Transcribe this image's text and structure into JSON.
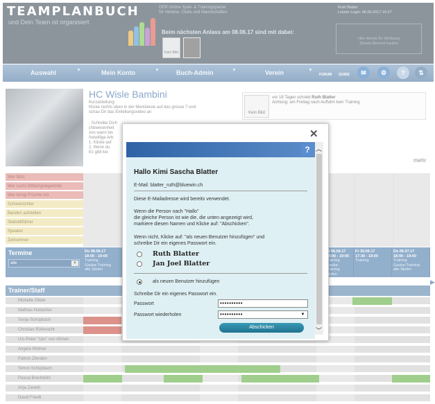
{
  "header": {
    "brand": "TEAMPLANBUCH",
    "tagline": "und Dein Team ist organisiert",
    "description_1": "DER Online Spiel- & Trainingsplaner",
    "description_2": "für Vereine, Clubs und Mannschaften",
    "user_name": "Ruth Blatter",
    "last_login": "Letzter Login: 06.06.2017 15:27",
    "next_event": "Beim nächsten Anlass am 08.06.17 sind mit dabei:",
    "kein_bild": "Kein Bild",
    "ad_line_1": "Hier könnte Ihr Werbung",
    "ad_line_2": "Diesen Bereich kaufen"
  },
  "nav": {
    "items": [
      "Auswahl",
      "Mein Konto",
      "Buch-Admin",
      "Verein"
    ],
    "forum": "FORUM",
    "guide": "GUIDE",
    "separator": "▼"
  },
  "club": {
    "title": "HC Wisle Bambini",
    "intro_label": "Kurzanleitung",
    "intro_1": "Klicke rechts oben in der Menüleiste auf das grosse ? und",
    "intro_2": "schau Dir das Einleitungsvideo an",
    "steps_1": "- Schreibe Dich",
    "steps_2": "(Abwesenheit",
    "steps_3": "von wann bis",
    "steps_4": "freiwillige Arb",
    "steps_5": "1. Klicke auf",
    "steps_6": "2. Wenn du",
    "steps_7": "Es gibt kei",
    "mehr": "mehr"
  },
  "message": {
    "kein_bild": "Kein Bild",
    "line_1_prefix": "vor 18 Tagen schrieb ",
    "author": "Ruth Blatter",
    "line_2": "Achtung: am Freitag nach Auffahrt kein Training"
  },
  "duties": [
    {
      "label": "Wer fährt",
      "tone": "red"
    },
    {
      "label": "Wer sucht Mitfahrgelegenheit",
      "tone": "red"
    },
    {
      "label": "Wer bringt Früchte mit",
      "tone": "red"
    },
    {
      "label": "Schiedsrichter",
      "tone": "yel"
    },
    {
      "label": "Banden aufstellen",
      "tone": "yel"
    },
    {
      "label": "Statistikführer",
      "tone": "yel"
    },
    {
      "label": "Speaker",
      "tone": "yel"
    },
    {
      "label": "Zeitnehmer",
      "tone": "yel"
    }
  ],
  "termine": {
    "label": "Termine",
    "select": "alle"
  },
  "events": [
    {
      "date": "Do 08.06.17",
      "time": "18:00 - 19:00",
      "l1": "Training",
      "l2": "Gauba-Training",
      "l3": "alle Stufen"
    },
    {
      "date": "Di 06.06.17",
      "time": "18:00 - 19:00",
      "l1": "Training",
      "l2": "Gauba-Training",
      "l3": "Stufen"
    },
    {
      "date": "Fr 30.06.17",
      "time": "17:30 - 19:00",
      "l1": "Training",
      "l2": "",
      "l3": ""
    },
    {
      "date": "Do 06.07.17",
      "time": "18:00 - 19:00",
      "l1": "Training",
      "l2": "Gauba-Training",
      "l3": "alle Stufen"
    }
  ],
  "trainer": {
    "label": "Trainer/Staff",
    "names": [
      "Michelle Ofeler",
      "Mathias Hubacher",
      "Sonja Schüpbach",
      "Christian Rüfenacht",
      "Urs-Peter \"Ups\" von Allmen",
      "Angela Widmer",
      "Patrick Zbinden",
      "Simon Schüpbach",
      "Pascal Brechbühl",
      "Anja Zanetti",
      "David Friedli"
    ]
  },
  "modal": {
    "close": "✕",
    "help": "?",
    "greeting": "Hallo Kimi Sascha Blatter",
    "email": "E-Mail: blatter_ruth@bluewin.ch",
    "used_notice": "Diese E-Mailadresse wird bereits verwendet.",
    "p1_l1": "Wenn die Person nach \"Hallo\"",
    "p1_l2": "die gleiche Person ist wie die, die unten angezeigt wird,",
    "p1_l3": "markiere diesen Namen und Klicke auf: \"Abschicken\".",
    "p2_l1": "Wenn nicht, Klicke auf: \"als neuen Benutzer hinzufügen\" und",
    "p2_l2": "schreibe Dir ein eigenes Passwort ein.",
    "person_1": "Ruth Blatter",
    "person_2": "Jan Joel Blatter",
    "new_user": "als neuen Benutzer hinzufügen",
    "pw_instruction": "Schreibe Dir ein eigenes Passwort ein.",
    "pw_label": "Passwort",
    "pw_value": "••••••••••",
    "pw_repeat_label": "Passwort wiederholen",
    "pw_repeat_value": "••••••••••",
    "submit": "Abschicken"
  }
}
